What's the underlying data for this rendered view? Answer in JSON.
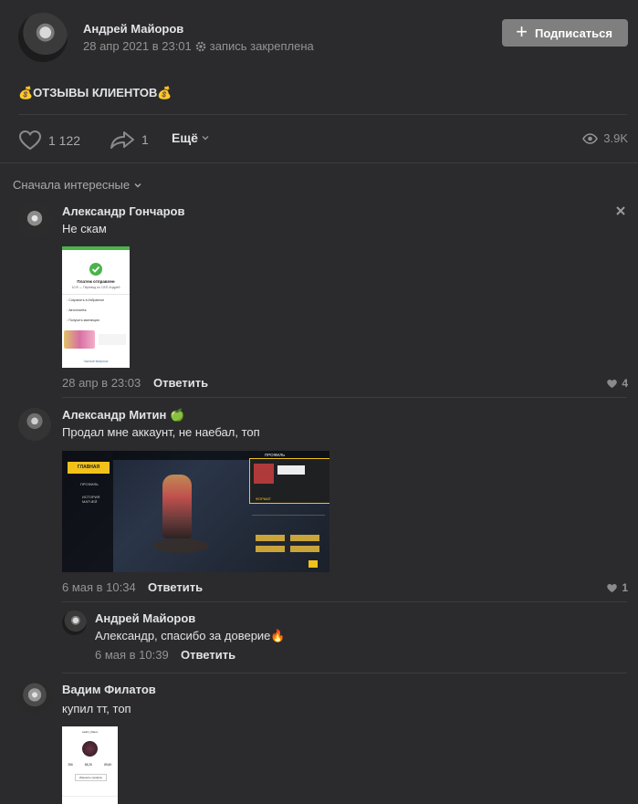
{
  "post": {
    "author": "Андрей Майоров",
    "date": "28 апр 2021 в 23:01",
    "pinned_label": "запись закреплена",
    "subscribe_label": "Подписаться",
    "text": "💰ОТЗЫВЫ КЛИЕНТОВ💰",
    "likes": "1 122",
    "shares": "1",
    "more_label": "Ещё",
    "views": "3.9K"
  },
  "comments_sort": "Сначала интересные",
  "comments": [
    {
      "author": "Александр Гончаров",
      "text": "Не скам",
      "date": "28 апр в 23:03",
      "reply_label": "Ответить",
      "likes": "4",
      "attachment": {
        "title": "Платеж отправлен",
        "subtitle": "10 ₽ — Перевод по СБП Андрей",
        "items": [
          "Сохранить в Избранное",
          "Автоплатёж",
          "Получить квитанцию"
        ],
        "footer": "Частые вопросы"
      }
    },
    {
      "author": "Александр Митин 🍏",
      "text": "Продал мне аккаунт, не наебал, топ",
      "date": "6 мая в 10:34",
      "reply_label": "Ответить",
      "likes": "1",
      "attachment": {
        "menu": [
          "ГЛАВНАЯ",
          "ПРОФИЛЬ",
          "ИСТОРИЯ МАТЧЕЙ"
        ],
        "top_tab": "ПРОФИЛЬ",
        "rank": "ФОРМАТ"
      },
      "replies": [
        {
          "author": "Андрей Майоров",
          "text": "Александр, спасибо за доверие🔥",
          "date": "6 мая в 10:39",
          "reply_label": "Ответить"
        }
      ]
    },
    {
      "author": "Вадим Филатов",
      "text": "купил тт, топ",
      "attachment": {
        "username": "vadim_filatov",
        "stats": [
          "356",
          "88,2K",
          "89,6K"
        ],
        "button": "Изменить профиль"
      }
    }
  ],
  "colors": {
    "background": "#2b2b2d",
    "text": "#e1e3e6",
    "secondary": "#939393",
    "button": "#7f7f7f",
    "success": "#4bb34b"
  }
}
